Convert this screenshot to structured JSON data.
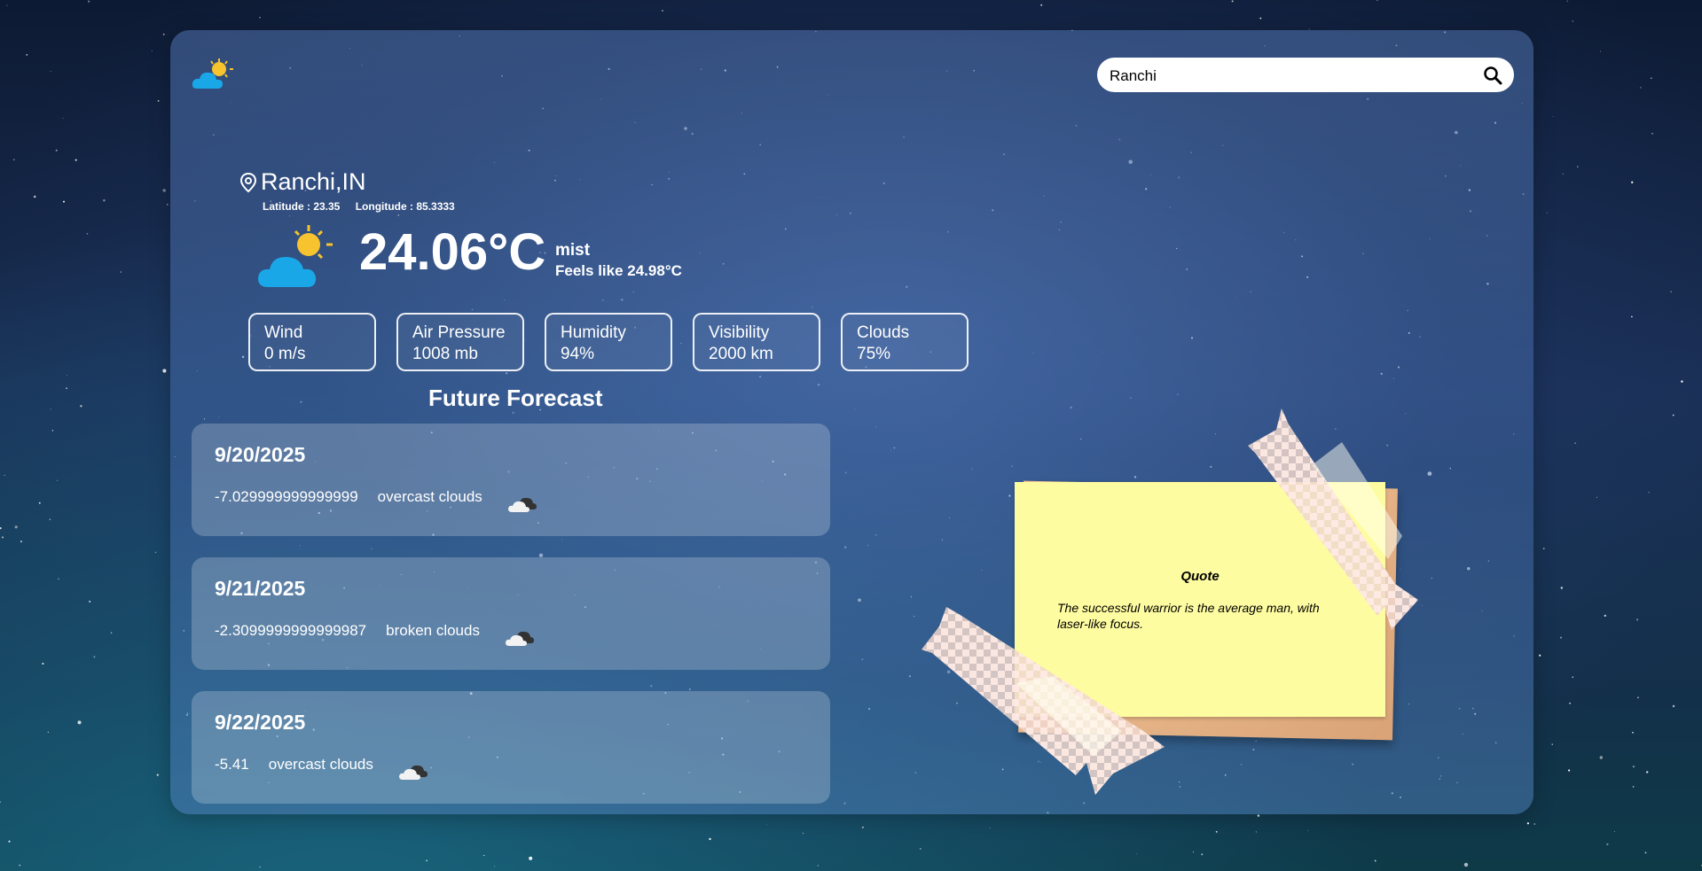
{
  "search": {
    "value": "Ranchi",
    "placeholder": ""
  },
  "location": {
    "city": "Ranchi,IN",
    "latitude": "Latitude : 23.35",
    "longitude": "Longitude : 85.3333"
  },
  "current": {
    "temperature": "24.06°C",
    "condition": "mist",
    "feels_like": "Feels like 24.98°C"
  },
  "stats": [
    {
      "label": "Wind",
      "value": "0 m/s"
    },
    {
      "label": "Air Pressure",
      "value": "1008 mb"
    },
    {
      "label": "Humidity",
      "value": "94%"
    },
    {
      "label": "Visibility",
      "value": "2000  km"
    },
    {
      "label": "Clouds",
      "value": "75%"
    }
  ],
  "forecast": {
    "title": "Future Forecast",
    "days": [
      {
        "date": "9/20/2025",
        "value": "-7.029999999999999",
        "condition": "overcast clouds",
        "icon": "overcast-clouds-icon"
      },
      {
        "date": "9/21/2025",
        "value": "-2.3099999999999987",
        "condition": "broken clouds",
        "icon": "broken-clouds-icon"
      },
      {
        "date": "9/22/2025",
        "value": "-5.41",
        "condition": "overcast clouds",
        "icon": "overcast-clouds-icon"
      }
    ]
  },
  "quote": {
    "title": "Quote",
    "text": "The successful warrior is the average man, with laser-like focus."
  },
  "colors": {
    "note": "#fefca0",
    "sun": "#f7c32e",
    "cloud": "#1aa7e8"
  }
}
